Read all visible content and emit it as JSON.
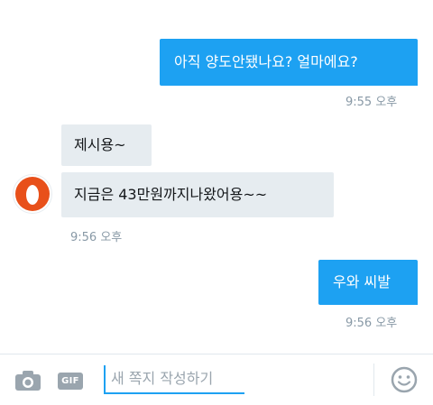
{
  "messages": [
    {
      "direction": "outgoing",
      "text": "아직 양도안됐나요? 얼마에요?",
      "time": "9:55 오후"
    },
    {
      "direction": "incoming",
      "text": "제시용~"
    },
    {
      "direction": "incoming",
      "text": "지금은 43만원까지나왔어용~~",
      "time": "9:56 오후"
    },
    {
      "direction": "outgoing",
      "text": "우와 씨발",
      "time": "9:56 오후"
    }
  ],
  "composer": {
    "placeholder": "새 쪽지 작성하기",
    "gif_label": "GIF",
    "camera_icon": "camera-icon",
    "emoji_icon": "smiley-icon"
  },
  "colors": {
    "outgoing_bubble": "#1da1f2",
    "incoming_bubble": "#e6ecf0",
    "avatar_accent": "#e8501a",
    "timestamp": "#8899a6"
  }
}
